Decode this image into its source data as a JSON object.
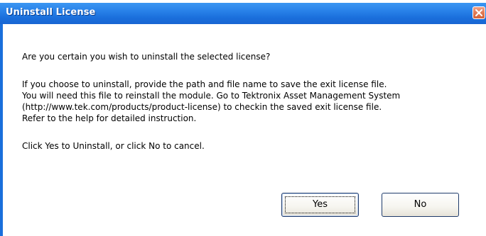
{
  "dialog": {
    "title": "Uninstall License",
    "close_icon": "close-x-icon",
    "messages": {
      "question": "Are you certain you wish to uninstall the selected license?",
      "line1": "If you choose to uninstall, provide the path and file name to save the exit license file.",
      "line2": "You will need this file to reinstall the module. Go to Tektronix Asset Management System",
      "line3": "(http://www.tek.com/products/product-license) to checkin the saved exit license file.",
      "line4": "Refer to the help for detailed instruction.",
      "instruction": "Click Yes to Uninstall, or click No to cancel."
    },
    "buttons": {
      "yes_label": "Yes",
      "no_label": "No"
    },
    "colors": {
      "titlebar": "#1a6fdc",
      "close_button": "#e07a55",
      "background": "#ffffff"
    }
  }
}
